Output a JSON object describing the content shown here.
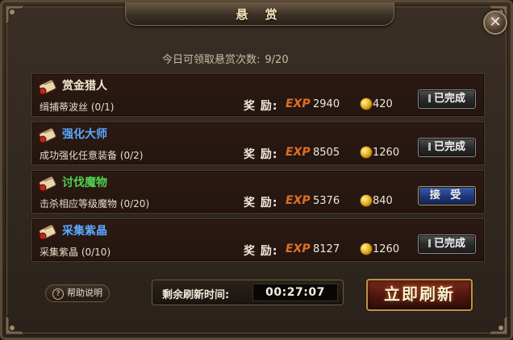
{
  "window": {
    "title": "悬 赏"
  },
  "quota": {
    "label": "今日可领取悬赏次数:",
    "value": "9/20"
  },
  "reward_label": "奖 励:",
  "exp_tag": "EXP",
  "quests": [
    {
      "name": "赏金猎人",
      "name_color": "#f4ead2",
      "desc": "缉捕蒂波丝 (0/1)",
      "exp": "2940",
      "gold": "420",
      "button": "已完成",
      "status": "done"
    },
    {
      "name": "强化大师",
      "name_color": "#5aa8ff",
      "desc": "成功强化任意装备 (0/2)",
      "exp": "8505",
      "gold": "1260",
      "button": "已完成",
      "status": "done"
    },
    {
      "name": "讨伐魔物",
      "name_color": "#4ed44e",
      "desc": "击杀相应等级魔物 (0/20)",
      "exp": "5376",
      "gold": "840",
      "button": "接 受",
      "status": "accept"
    },
    {
      "name": "采集紫晶",
      "name_color": "#5aa8ff",
      "desc": "采集紫晶 (0/10)",
      "exp": "8127",
      "gold": "1260",
      "button": "已完成",
      "status": "done"
    }
  ],
  "help": {
    "label": "帮助说明",
    "icon": "question-icon"
  },
  "timer": {
    "label": "剩余刷新时间:",
    "value": "00:27:07"
  },
  "refresh": {
    "label": "立即刷新"
  },
  "close": {
    "glyph": "✕",
    "icon": "close-icon"
  }
}
